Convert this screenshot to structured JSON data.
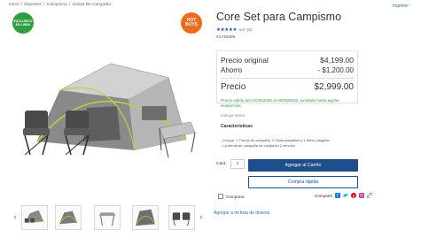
{
  "breadcrumb": [
    "Inicio",
    "/",
    "Deportes",
    "/",
    "Campismo",
    "/",
    "Casas De Campaña"
  ],
  "print_label": "Imprimir",
  "badges": {
    "online": "EXCLUSIVO EN LINEA",
    "hot": "HOT BUYS"
  },
  "product": {
    "title": "Core Set para Campismo",
    "stars": "★★★★★",
    "rating_score": "5.0",
    "rating_count": "(2)",
    "sku": "#1740698"
  },
  "pricing": {
    "original_label": "Precio original",
    "original_value": "$4,199.00",
    "savings_label": "Ahorro",
    "savings_value": "- $1,200.00",
    "price_label": "Precio",
    "price_value": "$2,999.00"
  },
  "validity": "Precio válido del 24/08/2026 al 30/09/2026. Limitado hasta agotar existencias.",
  "shipping": "Incluye envío",
  "features_title": "Características",
  "features": [
    "- Incluye: 1 Tienda de campaña, 2 Sillas plegables y 1 Mesa plegable",
    "- La tienda de campaña se instala en 2 minutos"
  ],
  "purchase": {
    "qty_label": "Cant.",
    "qty_value": "1",
    "add_to_cart": "Agregar al Carrito",
    "quick_buy": "Compra rápida"
  },
  "compare_label": "Comparar",
  "share_label": "Compartir",
  "wishlist_label": "Agregar a mi lista de deseos",
  "colors": {
    "accent": "#1f4e8c",
    "link": "#2a6fb5",
    "badge_online": "#2f9e3f",
    "badge_hot": "#f26a1b",
    "validity_text": "#2f9e3f"
  },
  "icons": [
    "thumb-prev-icon",
    "thumb-next-icon",
    "facebook-icon",
    "twitter-icon",
    "pinterest-icon",
    "instagram-icon",
    "link-icon"
  ]
}
